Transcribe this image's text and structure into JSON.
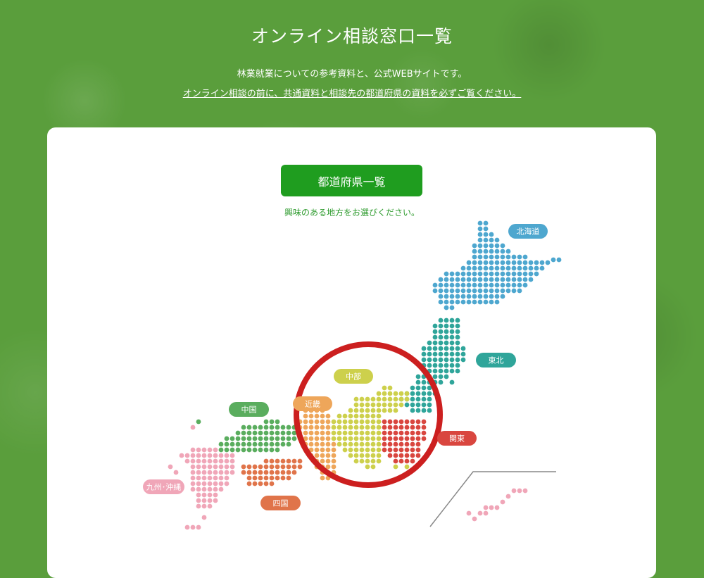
{
  "header": {
    "title": "オンライン相談窓口一覧",
    "subtitle": "林業就業についての参考資料と、公式WEBサイトです。",
    "notice": "オンライン相談の前に、共通資料と相談先の都道府県の資料を必ずご覧ください。"
  },
  "main": {
    "button_label": "都道府県一覧",
    "instruction": "興味のある地方をお選びください。"
  },
  "regions": [
    {
      "key": "hokkaido",
      "label": "北海道",
      "color": "#4ea7cf"
    },
    {
      "key": "tohoku",
      "label": "東北",
      "color": "#2fa59a"
    },
    {
      "key": "chubu",
      "label": "中部",
      "color": "#cdd04c"
    },
    {
      "key": "kanto",
      "label": "関東",
      "color": "#d9463f"
    },
    {
      "key": "kinki",
      "label": "近畿",
      "color": "#eea65a"
    },
    {
      "key": "chugoku",
      "label": "中国",
      "color": "#5aad5e"
    },
    {
      "key": "shikoku",
      "label": "四国",
      "color": "#e0744a"
    },
    {
      "key": "kyushu",
      "label": "九州･沖縄",
      "color": "#f0a6b8"
    }
  ],
  "highlight_color": "#cc1f1f"
}
